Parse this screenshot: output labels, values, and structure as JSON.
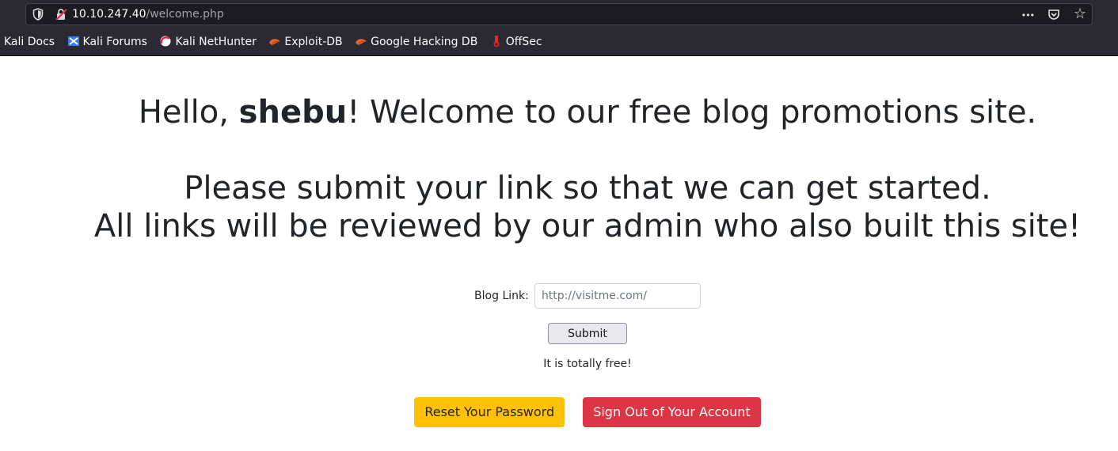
{
  "browser": {
    "url_host": "10.10.247.40",
    "url_path": "/welcome.php",
    "actions": [
      {
        "icon": "more-icon",
        "glyph": "•••"
      },
      {
        "icon": "pocket-icon",
        "glyph": "⛉"
      },
      {
        "icon": "star-icon",
        "glyph": "☆"
      }
    ],
    "bookmarks": [
      {
        "label": "Kali Docs"
      },
      {
        "label": "Kali Forums"
      },
      {
        "label": "Kali NetHunter"
      },
      {
        "label": "Exploit-DB"
      },
      {
        "label": "Google Hacking DB"
      },
      {
        "label": "OffSec"
      }
    ]
  },
  "page": {
    "greeting_prefix": "Hello, ",
    "username": "shebu",
    "greeting_suffix": "! Welcome to our free blog promotions site.",
    "message_line1": "Please submit your link so that we can get started.",
    "message_line2": "All links will be reviewed by our admin who also built this site!",
    "form": {
      "label": "Blog Link:",
      "placeholder": "http://visitme.com/",
      "submit_label": "Submit"
    },
    "free_note": "It is totally free!",
    "reset_label": "Reset Your Password",
    "signout_label": "Sign Out of Your Account"
  },
  "colors": {
    "warning": "#ffc107",
    "danger": "#dc3545",
    "chrome_bg": "#2b2a33"
  }
}
